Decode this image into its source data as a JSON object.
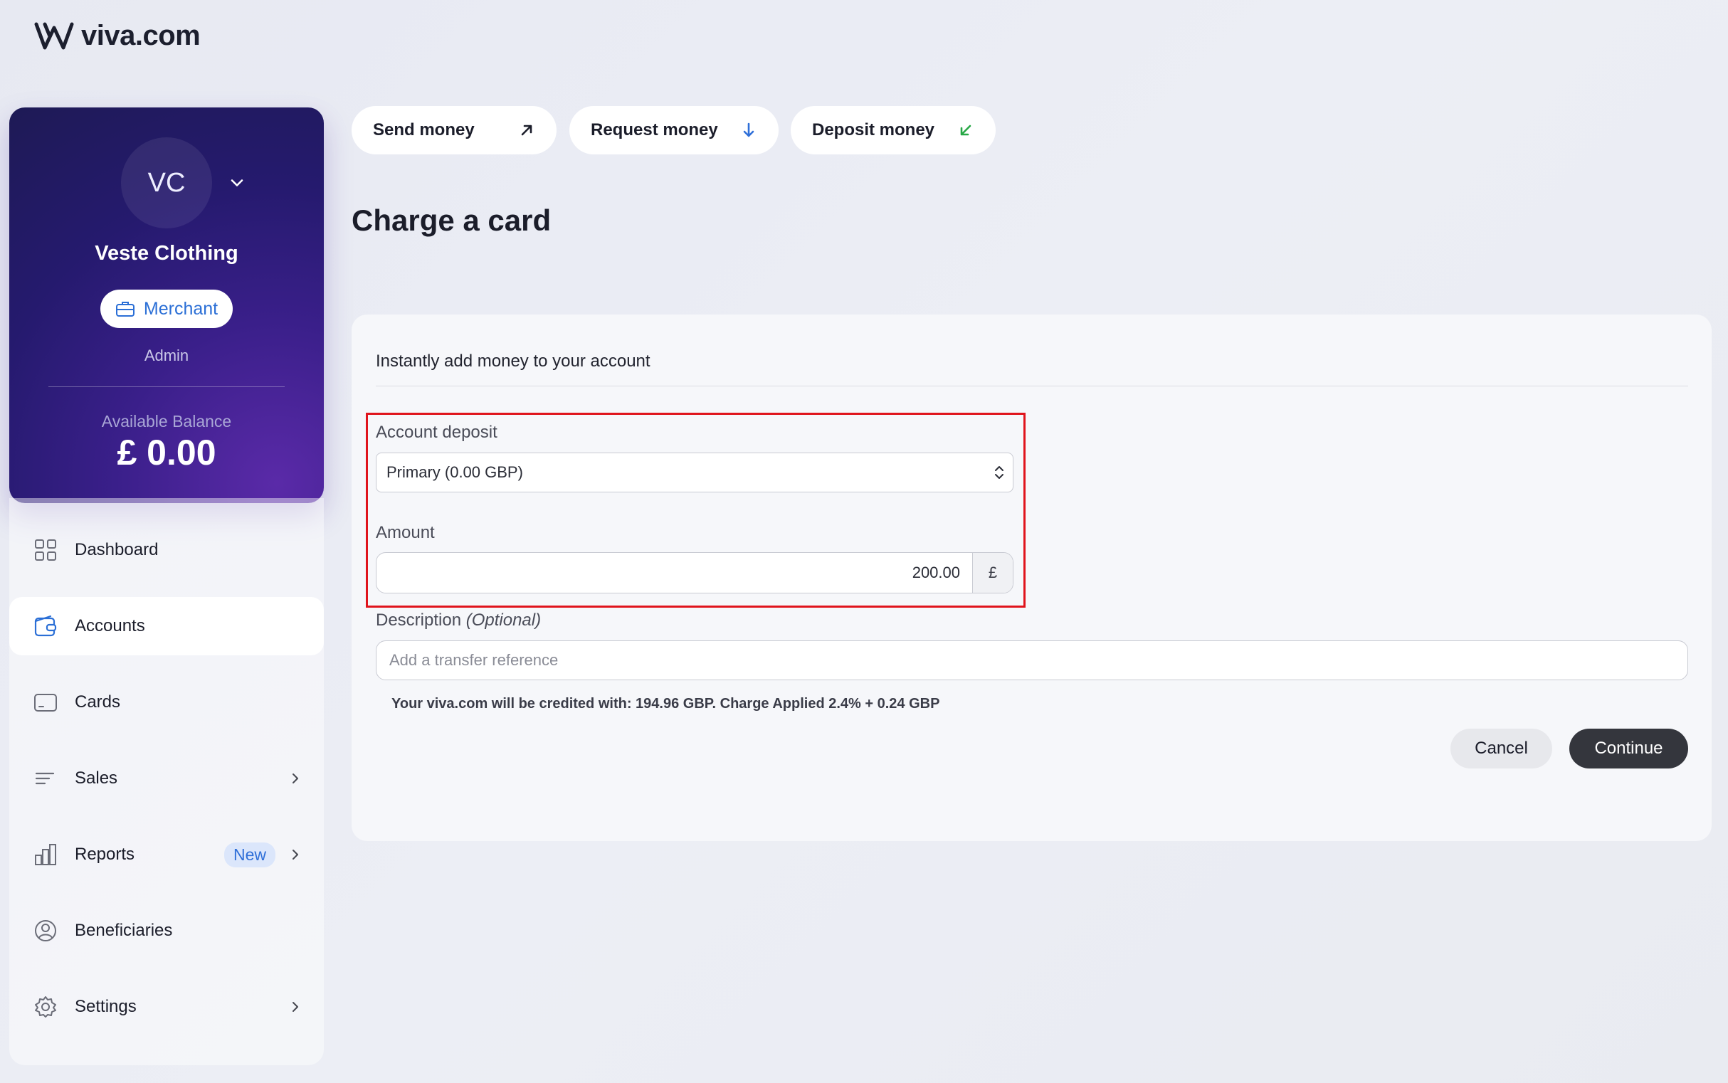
{
  "app": {
    "logo_text": "viva.com"
  },
  "profile": {
    "initials": "VC",
    "name": "Veste Clothing",
    "badge": "Merchant",
    "role": "Admin",
    "balance_label": "Available Balance",
    "balance_value": "£ 0.00"
  },
  "nav": {
    "items": [
      {
        "label": "Dashboard",
        "icon": "grid-icon"
      },
      {
        "label": "Accounts",
        "icon": "wallet-icon",
        "active": true
      },
      {
        "label": "Cards",
        "icon": "card-icon"
      },
      {
        "label": "Sales",
        "icon": "list-icon"
      },
      {
        "label": "Reports",
        "icon": "bar-chart-icon",
        "badge": "New"
      },
      {
        "label": "Beneficiaries",
        "icon": "user-circle-icon"
      },
      {
        "label": "Settings",
        "icon": "gear-icon"
      }
    ]
  },
  "actions": {
    "send": "Send money",
    "request": "Request money",
    "deposit": "Deposit money"
  },
  "colors": {
    "request_arrow": "#2f6fd8",
    "deposit_arrow": "#27a745",
    "highlight": "#e0141c"
  },
  "page": {
    "title": "Charge a card"
  },
  "form": {
    "intro": "Instantly add money to your account",
    "account_label": "Account deposit",
    "account_value": "Primary (0.00 GBP)",
    "amount_label": "Amount",
    "amount_value": "200.00",
    "currency_symbol": "£",
    "description_label": "Description",
    "description_optional": "(Optional)",
    "description_placeholder": "Add a transfer reference",
    "credit_note": "Your viva.com will be credited with: 194.96 GBP. Charge Applied 2.4% + 0.24 GBP",
    "cancel_label": "Cancel",
    "continue_label": "Continue"
  }
}
